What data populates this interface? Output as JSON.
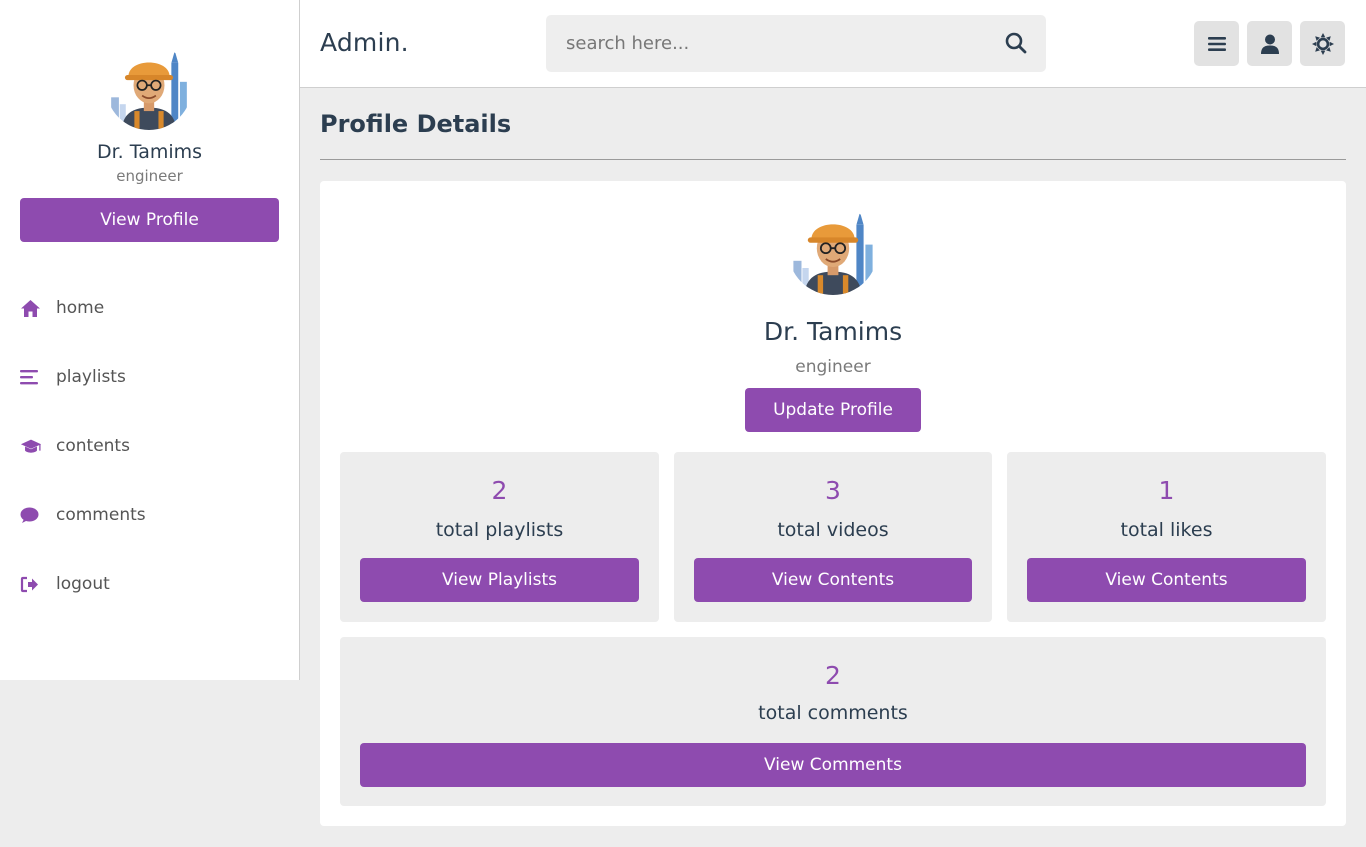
{
  "header": {
    "logo": "Admin.",
    "search_placeholder": "search here...",
    "icons": [
      "menu-icon",
      "user-icon",
      "theme-toggle-icon"
    ]
  },
  "sidebar": {
    "name": "Dr. Tamims",
    "role": "engineer",
    "view_profile": "View Profile",
    "items": [
      {
        "label": "home",
        "icon": "home-icon"
      },
      {
        "label": "playlists",
        "icon": "list-icon"
      },
      {
        "label": "contents",
        "icon": "graduation-cap-icon"
      },
      {
        "label": "comments",
        "icon": "comment-icon"
      },
      {
        "label": "logout",
        "icon": "logout-icon"
      }
    ]
  },
  "main": {
    "title": "Profile Details",
    "name": "Dr. Tamims",
    "role": "engineer",
    "update_button": "Update Profile",
    "stats": [
      {
        "value": "2",
        "label": "total playlists",
        "button": "View Playlists"
      },
      {
        "value": "3",
        "label": "total videos",
        "button": "View Contents"
      },
      {
        "value": "1",
        "label": "total likes",
        "button": "View Contents"
      },
      {
        "value": "2",
        "label": "total comments",
        "button": "View Comments"
      }
    ]
  },
  "colors": {
    "accent": "#8e4baf",
    "text": "#2c3e50",
    "background": "#ededed"
  }
}
